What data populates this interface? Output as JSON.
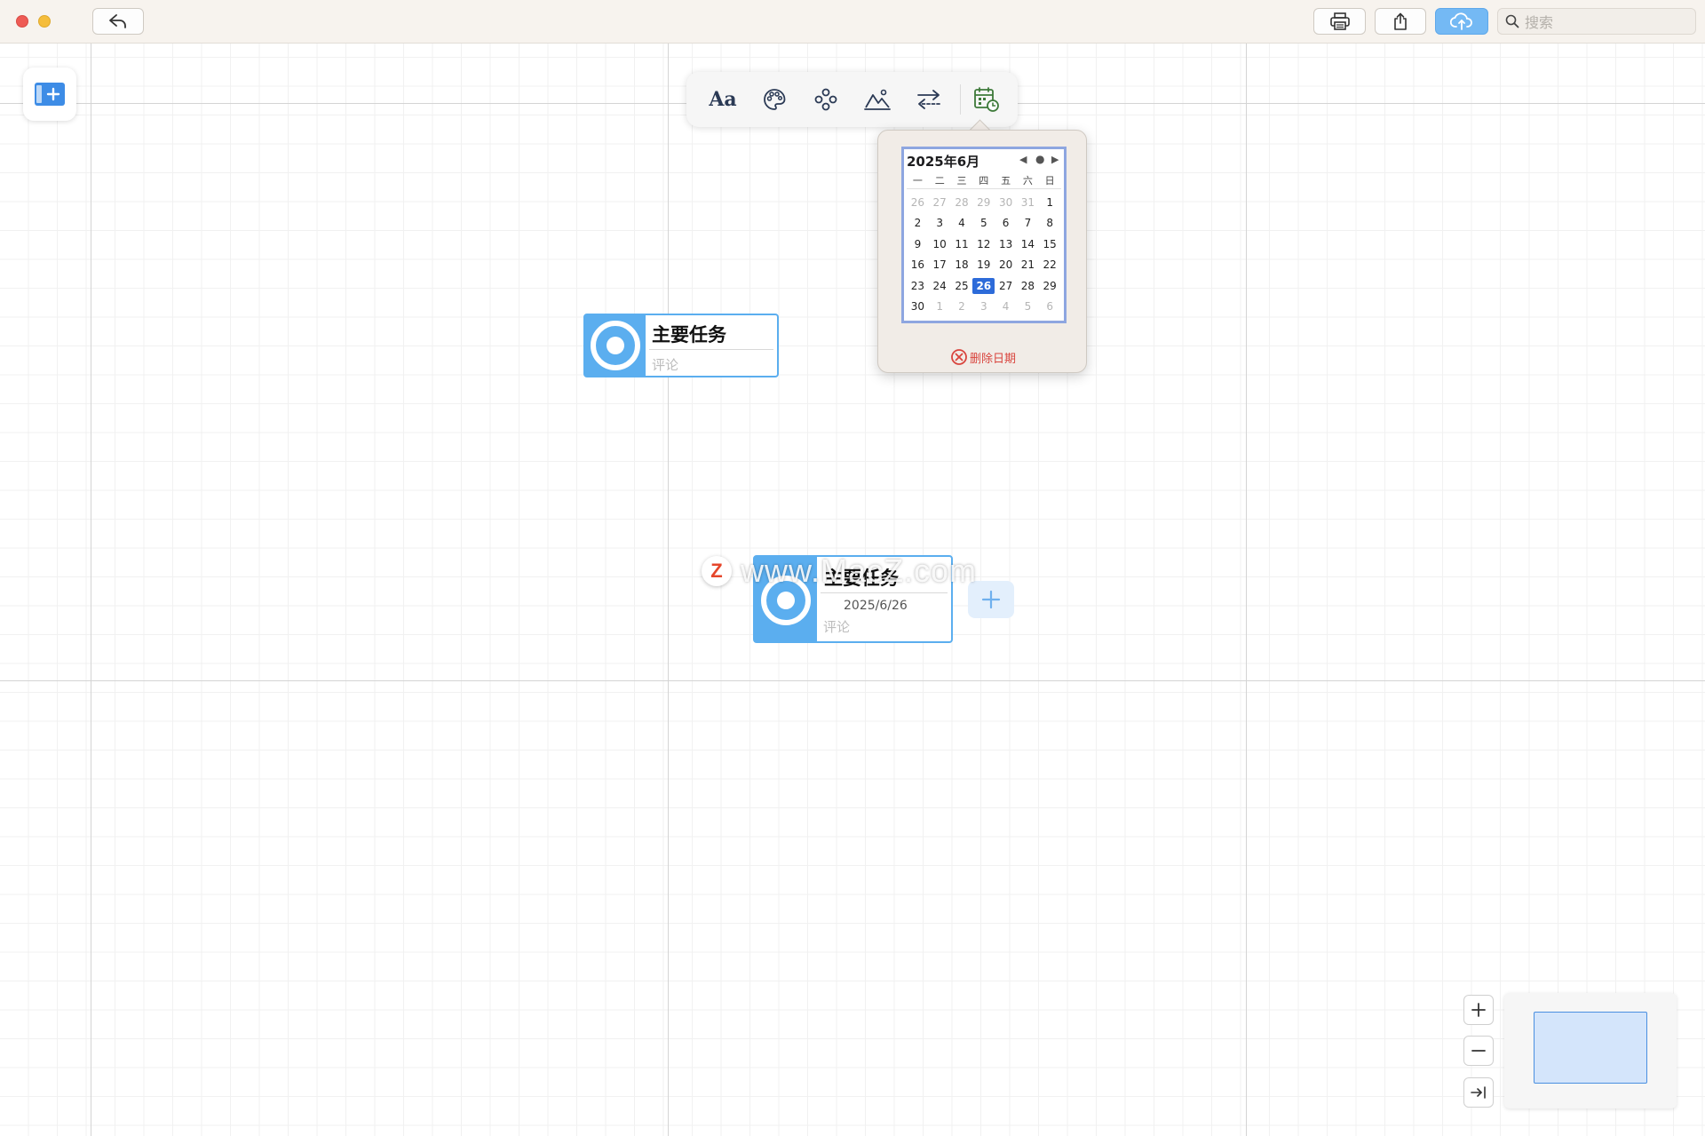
{
  "titlebar": {
    "search_placeholder": "搜索"
  },
  "toolbar": {
    "buttons": [
      {
        "name": "font",
        "label": "Aa"
      },
      {
        "name": "palette-icon"
      },
      {
        "name": "structure-icon"
      },
      {
        "name": "image-icon"
      },
      {
        "name": "swap-icon"
      },
      {
        "name": "calendar-icon"
      }
    ],
    "colors": {
      "icon": "#2b3a55",
      "calendar_icon": "#3e7a3a"
    }
  },
  "date_popover": {
    "title": "2025年6月",
    "weekdays": [
      "一",
      "二",
      "三",
      "四",
      "五",
      "六",
      "日"
    ],
    "weeks": [
      [
        "26",
        "27",
        "28",
        "29",
        "30",
        "31",
        "1"
      ],
      [
        "2",
        "3",
        "4",
        "5",
        "6",
        "7",
        "8"
      ],
      [
        "9",
        "10",
        "11",
        "12",
        "13",
        "14",
        "15"
      ],
      [
        "16",
        "17",
        "18",
        "19",
        "20",
        "21",
        "22"
      ],
      [
        "23",
        "24",
        "25",
        "26",
        "27",
        "28",
        "29"
      ],
      [
        "30",
        "1",
        "2",
        "3",
        "4",
        "5",
        "6"
      ]
    ],
    "selected": "26",
    "delete_label": "删除日期"
  },
  "topics": [
    {
      "title": "主要任务",
      "comment": "评论"
    },
    {
      "title": "主要任务",
      "date": "2025/6/26",
      "comment": "评论"
    }
  ],
  "watermark": {
    "logo": "Z",
    "text": "www.MacZ.com"
  },
  "colors": {
    "accent": "#5baeef",
    "selected_day": "#2d6bd9",
    "delete": "#d9453e",
    "cloud_button": "#74b9f4"
  }
}
